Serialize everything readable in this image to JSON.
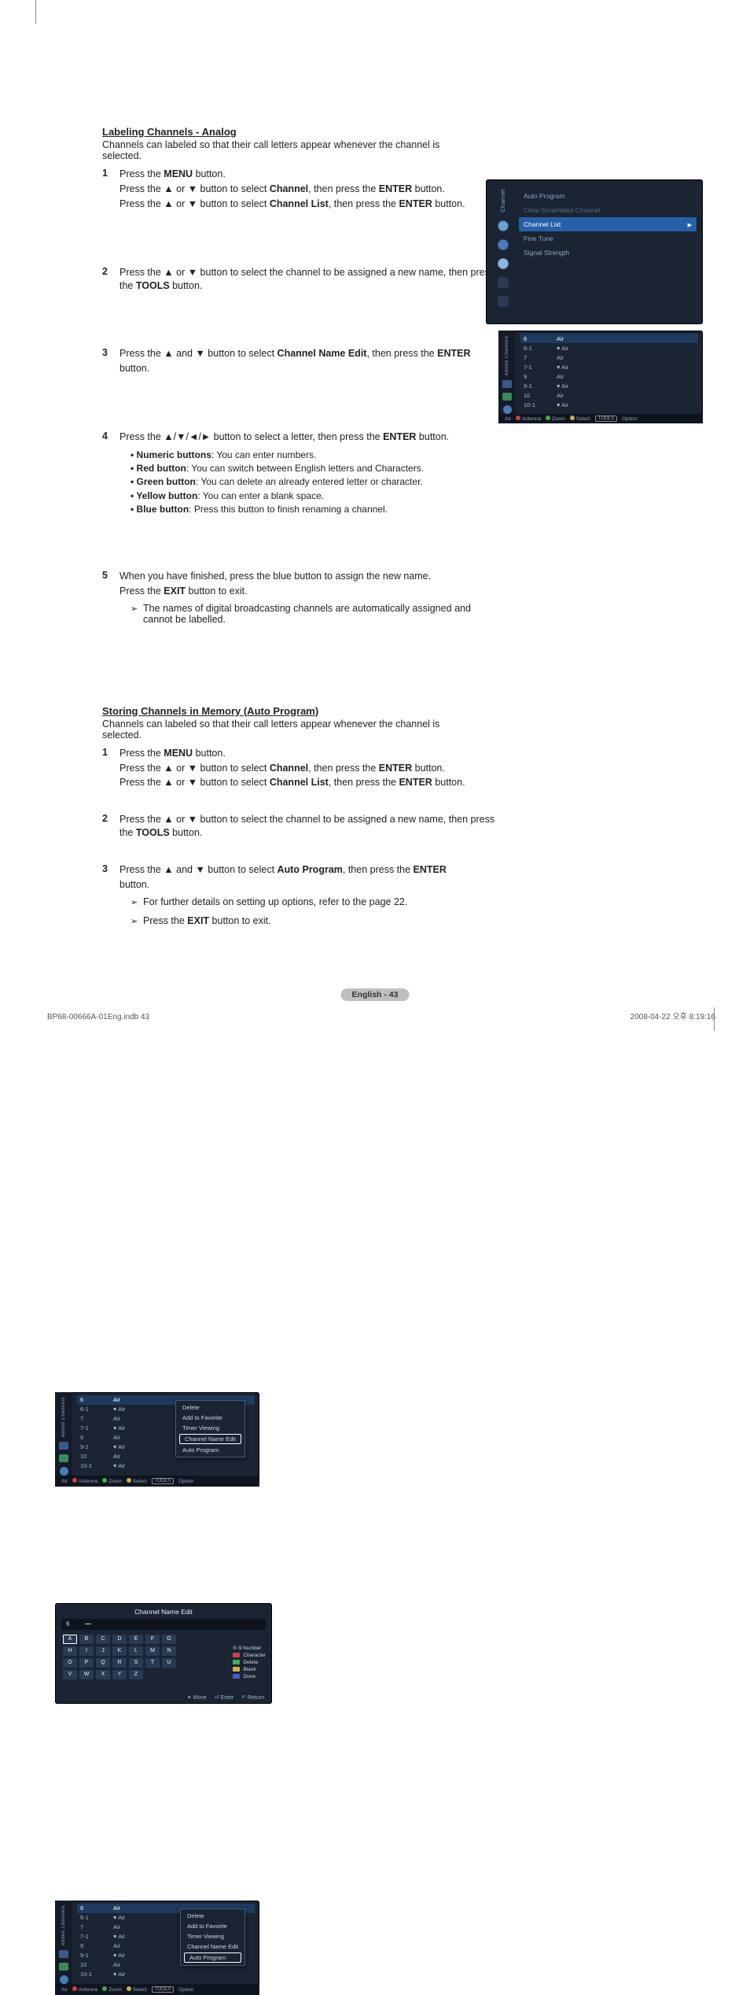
{
  "sect1": {
    "title": "Labeling Channels - Analog",
    "intro": "Channels can labeled so that their call letters appear whenever the channel is selected."
  },
  "step1": {
    "num": "1",
    "l1a": "Press the ",
    "l1b": "MENU",
    "l1c": " button.",
    "l2a": "Press the ▲ or ▼ button to select ",
    "l2b": "Channel",
    "l2c": ", then press the ",
    "l2d": "ENTER",
    "l2e": " button.",
    "l3a": "Press the ▲ or ▼ button to select ",
    "l3b": "Channel List",
    "l3c": ", then press the ",
    "l3d": "ENTER",
    "l3e": " button."
  },
  "step2": {
    "num": "2",
    "l1a": "Press the ▲ or ▼ button to select the channel to be assigned a new name, then press the ",
    "l1b": "TOOLS",
    "l1c": " button."
  },
  "step3": {
    "num": "3",
    "l1a": "Press the ▲ and ▼ button to select ",
    "l1b": "Channel Name Edit",
    "l1c": ", then press the ",
    "l1d": "ENTER",
    "l1e": "button."
  },
  "step4": {
    "num": "4",
    "l1a": "Press the ▲/▼/◄/► button to select a letter, then press the ",
    "l1b": "ENTER",
    "l1c": " button.",
    "b1a": "• Numeric buttons",
    "b1b": ": You can enter numbers.",
    "b2a": "• Red button",
    "b2b": ": You can switch between English letters and Characters.",
    "b3a": "• Green button",
    "b3b": ": You can delete an already entered letter or character.",
    "b4a": "• Yellow button",
    "b4b": ": You can enter a blank space.",
    "b5a": "• Blue button",
    "b5b": ": Press this button to finish renaming a channel."
  },
  "step5": {
    "num": "5",
    "l1": "When you have finished, press the blue button to assign the new name.",
    "l2a": "Press the ",
    "l2b": "EXIT",
    "l2c": " button to exit.",
    "n1": "The names of digital broadcasting channels are automatically assigned and cannot be labelled."
  },
  "sect2": {
    "title": "Storing Channels in Memory (Auto Program)",
    "intro": "Channels can labeled so that their call letters appear whenever the channel is selected."
  },
  "s2step1": {
    "num": "1",
    "l1a": "Press the ",
    "l1b": "MENU",
    "l1c": " button.",
    "l2a": "Press the ▲ or ▼ button to select ",
    "l2b": "Channel",
    "l2c": ", then press the ",
    "l2d": "ENTER",
    "l2e": " button.",
    "l3a": "Press the ▲ or ▼ button to select ",
    "l3b": "Channel List",
    "l3c": ", then press the ",
    "l3d": "ENTER",
    "l3e": " button."
  },
  "s2step2": {
    "num": "2",
    "l1a": "Press the ▲ or ▼ button to select the channel to be assigned a new name, then press the ",
    "l1b": "TOOLS",
    "l1c": " button."
  },
  "s2step3": {
    "num": "3",
    "l1a": "Press the ▲ and ▼ button to select ",
    "l1b": "Auto Program",
    "l1c": ", then press the ",
    "l1d": "ENTER",
    "l1e": "button.",
    "n1": "For further details on setting up options, refer to the page 22.",
    "n2a": "Press the ",
    "n2b": "EXIT",
    "n2c": " button to exit."
  },
  "menu1": {
    "side": "Channel",
    "i1": "Auto Program",
    "i2": "Clear Scrambled Channel",
    "i3": "Channel List",
    "i4": "Fine Tune",
    "i5": "Signal Strength"
  },
  "chlist": {
    "side": "Added Channels",
    "rows": [
      {
        "n": "6",
        "t": "Air"
      },
      {
        "n": "6-1",
        "t": "♥ Air"
      },
      {
        "n": "7",
        "t": "Air"
      },
      {
        "n": "7-1",
        "t": "♥ Air"
      },
      {
        "n": "9",
        "t": "Air"
      },
      {
        "n": "9-1",
        "t": "♥ Air"
      },
      {
        "n": "10",
        "t": "Air"
      },
      {
        "n": "10-1",
        "t": "♥ Air"
      }
    ],
    "foot": {
      "air": "Air",
      "ant": "Antenna",
      "zoom": "Zoom",
      "sel": "Select",
      "tools": "TOOLS",
      "opt": "Option"
    }
  },
  "popup3": {
    "i1": "Delete",
    "i2": "Add to Favorite",
    "i3": "Timer Viewing",
    "i4": "Channel Name Edit",
    "i5": "Auto Program"
  },
  "popup5": {
    "i1": "Delete",
    "i2": "Add to Favorite",
    "i3": "Timer Viewing",
    "i4": "Channel Name Edit",
    "i5": "Auto Program"
  },
  "edit4": {
    "title": "Channel Name Edit",
    "ch": "6",
    "grid": [
      "A",
      "B",
      "C",
      "D",
      "E",
      "F",
      "G",
      "H",
      "I",
      "J",
      "K",
      "L",
      "M",
      "N",
      "O",
      "P",
      "Q",
      "R",
      "S",
      "T",
      "U",
      "V",
      "W",
      "X",
      "Y",
      "Z"
    ],
    "leg": {
      "num": "0~9 Number",
      "char": "Character",
      "del": "Delete",
      "blank": "Blank",
      "done": "Done"
    },
    "foot": {
      "move": "Move",
      "enter": "Enter",
      "ret": "Return"
    }
  },
  "pagenum": "English - 43",
  "footerL": "BP68-00666A-01Eng.indb   43",
  "footerR": "2008-04-22   오후 8:19:16"
}
